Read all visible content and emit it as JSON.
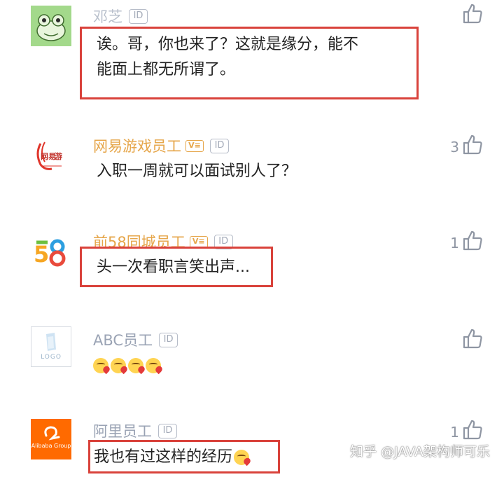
{
  "comments": [
    {
      "user": "邓芝",
      "id_badge": "ID",
      "verified": false,
      "lines": [
        "诶。哥，你也来了？这就是缘分，能不",
        "能面上都无所谓了。"
      ],
      "likes": "",
      "avatar_icon": "frog-avatar-icon"
    },
    {
      "user": "网易游戏员工",
      "id_badge": "ID",
      "verified_badge": "V≡",
      "verified": true,
      "lines": [
        "入职一周就可以面试别人了？"
      ],
      "likes": "3",
      "avatar_icon": "netease-logo-icon"
    },
    {
      "user": "前58同城员工",
      "id_badge": "ID",
      "verified_badge": "V≡",
      "verified": true,
      "lines": [
        "头一次看职言笑出声..."
      ],
      "likes": "1",
      "avatar_icon": "58-logo-icon"
    },
    {
      "user": "ABC员工",
      "id_badge": "ID",
      "verified": false,
      "lines": [
        ""
      ],
      "emoji_count": 4,
      "likes": "",
      "avatar_icon": "logo-placeholder-icon",
      "avatar_text": "LOGO"
    },
    {
      "user": "阿里员工",
      "id_badge": "ID",
      "verified": false,
      "lines": [
        "我也有过这样的经历"
      ],
      "likes": "1",
      "avatar_icon": "alibaba-logo-icon",
      "avatar_text": "Alibaba Group"
    }
  ],
  "watermark": "知乎 @JAVA架构师可乐",
  "colors": {
    "highlight": "#d9423b",
    "verified": "#e6a64a",
    "alibaba": "#ff6a00"
  }
}
